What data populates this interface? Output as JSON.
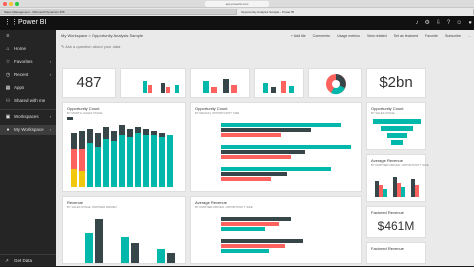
{
  "browser": {
    "url": "app.powerbi.com",
    "tabs": [
      "Sales Management - Microsoft Dynamics 365",
      "Opportunity Analysis Sample - Power BI"
    ]
  },
  "app": {
    "brand": "Power BI"
  },
  "sidebar": {
    "items": [
      {
        "icon": "home-icon",
        "glyph": "⌂",
        "label": "Home"
      },
      {
        "icon": "star-icon",
        "glyph": "☆",
        "label": "Favorites"
      },
      {
        "icon": "clock-icon",
        "glyph": "◷",
        "label": "Recent"
      },
      {
        "icon": "apps-icon",
        "glyph": "▦",
        "label": "Apps"
      },
      {
        "icon": "people-icon",
        "glyph": "⚇",
        "label": "Shared with me"
      },
      {
        "icon": "workspace-icon",
        "glyph": "▣",
        "label": "Workspaces"
      },
      {
        "icon": "avatar-icon",
        "glyph": "●",
        "label": "My Workspace"
      }
    ],
    "get_data": "Get Data"
  },
  "header": {
    "breadcrumb": "My Workspace  >  Opportunity Analysis Sample",
    "actions": [
      "+ Add tile",
      "Comments",
      "Usage metrics",
      "View related",
      "Set as featured",
      "Favorite",
      "Subscribe",
      "..."
    ]
  },
  "qa_placeholder": "Ask a question about your data",
  "tiles": {
    "count": {
      "value": "487"
    },
    "revenue_total": {
      "value": "$2bn"
    },
    "opp_by_month": {
      "title": "Opportunity Count",
      "subtitle": "BY MONTH, SALES STAGE"
    },
    "opp_by_region": {
      "title": "Opportunity Count",
      "subtitle": "BY REGION, OPPORTUNITY SIZE"
    },
    "opp_funnel": {
      "title": "Opportunity Count",
      "subtitle": "BY SALES STAGE"
    },
    "avg_revenue_partner": {
      "title": "Average Revenue",
      "subtitle": "BY PARTNER DRIVEN, OPPORTUNITY SIZE"
    },
    "revenue_partner": {
      "title": "Revenue",
      "subtitle": "BY SALES STAGE, PARTNER DRIVEN"
    },
    "avg_revenue_size": {
      "title": "Average Revenue",
      "subtitle": "BY PARTNER DRIVEN, OPPORTUNITY SIZE"
    },
    "factored_revenue": {
      "title": "Factored Revenue"
    },
    "factored_revenue_2": {
      "title": "Factored Revenue",
      "value": "$461M"
    }
  },
  "colors": {
    "teal": "#01b8aa",
    "dark": "#374649",
    "red": "#fd625e",
    "yellow": "#f2c80f",
    "gray": "#5f6b6d"
  }
}
